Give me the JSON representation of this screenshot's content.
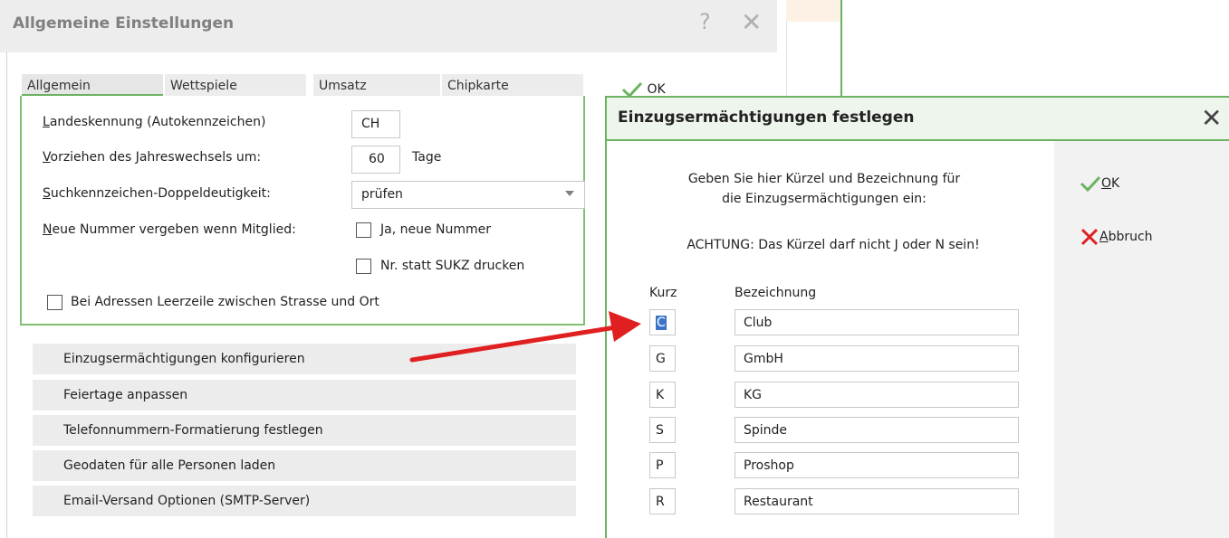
{
  "settings_dialog": {
    "title": "Allgemeine Einstellungen",
    "help_glyph": "?",
    "close_glyph": "✕",
    "tabs": [
      "Allgemein",
      "Wettspiele",
      "Umsatz",
      "Chipkarte"
    ],
    "active_tab": "Allgemein",
    "fields": {
      "country_code": {
        "label_accel": "L",
        "label_rest": "andeskennung (Autokennzeichen)",
        "value": "CH"
      },
      "year_shift": {
        "label_accel": "V",
        "label_rest": "orziehen des Jahreswechsels um:",
        "value": "60",
        "unit": "Tage"
      },
      "search_code": {
        "label_accel": "S",
        "label_rest": "uchkennzeichen-Doppeldeutigkeit:",
        "value": "prüfen"
      },
      "new_number": {
        "label_accel": "N",
        "label_rest": "eue Nummer vergeben wenn Mitglied:",
        "checkbox1": "Ja, neue Nummer",
        "checkbox2": "Nr. statt SUKZ drucken"
      },
      "address_blank": {
        "label": "Bei Adressen Leerzeile zwischen Strasse und Ort"
      }
    },
    "ok_label": "OK",
    "buttons": [
      "Einzugsermächtigungen konfigurieren",
      "Feiertage anpassen",
      "Telefonnummern-Formatierung festlegen",
      "Geodaten für alle Personen laden",
      "Email-Versand Optionen (SMTP-Server)"
    ]
  },
  "mandate_dialog": {
    "title": "Einzugsermächtigungen festlegen",
    "close_glyph": "✕",
    "instruction_line1": "Geben Sie hier Kürzel und Bezeichnung für",
    "instruction_line2": "die Einzugsermächtigungen ein:",
    "warning": "ACHTUNG: Das Kürzel darf nicht J oder N sein!",
    "col_short": "Kurz",
    "col_name": "Bezeichnung",
    "rows": [
      {
        "short": "C",
        "name": "Club"
      },
      {
        "short": "G",
        "name": "GmbH"
      },
      {
        "short": "K",
        "name": "KG"
      },
      {
        "short": "S",
        "name": "Spinde"
      },
      {
        "short": "P",
        "name": "Proshop"
      },
      {
        "short": "R",
        "name": "Restaurant"
      }
    ],
    "ok_accel": "O",
    "ok_rest": "K",
    "cancel_accel": "A",
    "cancel_rest": "bbruch"
  },
  "colors": {
    "accent_green": "#6bb360",
    "arrow_red": "#e02020",
    "selection_blue": "#3b74c7"
  }
}
